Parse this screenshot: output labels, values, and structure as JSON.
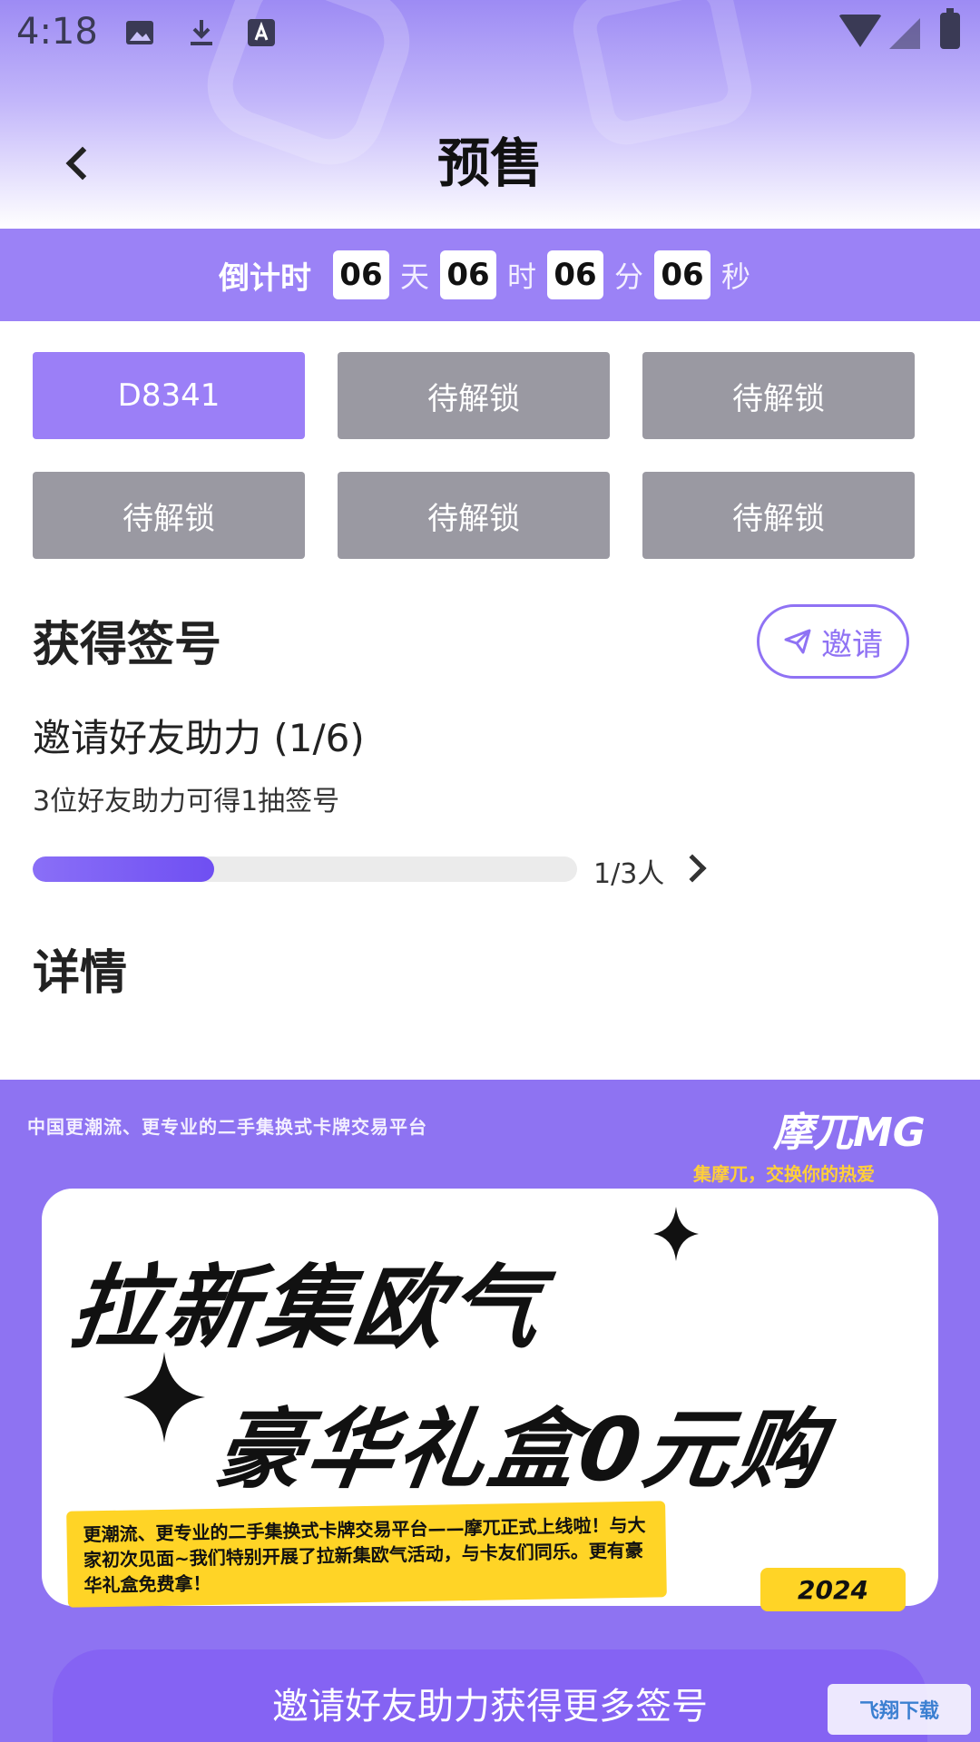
{
  "status_bar": {
    "time": "4:18"
  },
  "header": {
    "title": "预售"
  },
  "countdown": {
    "label": "倒计时",
    "days": "06",
    "days_unit": "天",
    "hours": "06",
    "hours_unit": "时",
    "minutes": "06",
    "minutes_unit": "分",
    "seconds": "06",
    "seconds_unit": "秒"
  },
  "slots": [
    "D8341",
    "待解锁",
    "待解锁",
    "待解锁",
    "待解锁",
    "待解锁"
  ],
  "get_number": {
    "title": "获得签号",
    "invite_label": "邀请",
    "task_title": "邀请好友助力 (1/6)",
    "task_desc": "3位好友助力可得1抽签号",
    "progress_fraction": 0.333,
    "progress_text": "1/3人"
  },
  "details": {
    "title": "详情"
  },
  "banner": {
    "subtitle": "中国更潮流、更专业的二手集换式卡牌交易平台",
    "logo": "摩兀MG",
    "slogan": "集摩兀，交换你的热爱",
    "headline1": "拉新集欧气",
    "headline2": "豪华礼盒0元购",
    "note": "更潮流、更专业的二手集换式卡牌交易平台——摩兀正式上线啦！与大家初次见面~我们特别开展了拉新集欧气活动，与卡友们同乐。更有豪华礼盒免费拿！",
    "year": "2024"
  },
  "bottom_button": {
    "label": "邀请好友助力获得更多签号"
  },
  "watermark": {
    "text": "飞翔下载"
  },
  "colors": {
    "accent": "#9b82f6",
    "locked": "#9a99a2",
    "cta": "#8563f3"
  }
}
